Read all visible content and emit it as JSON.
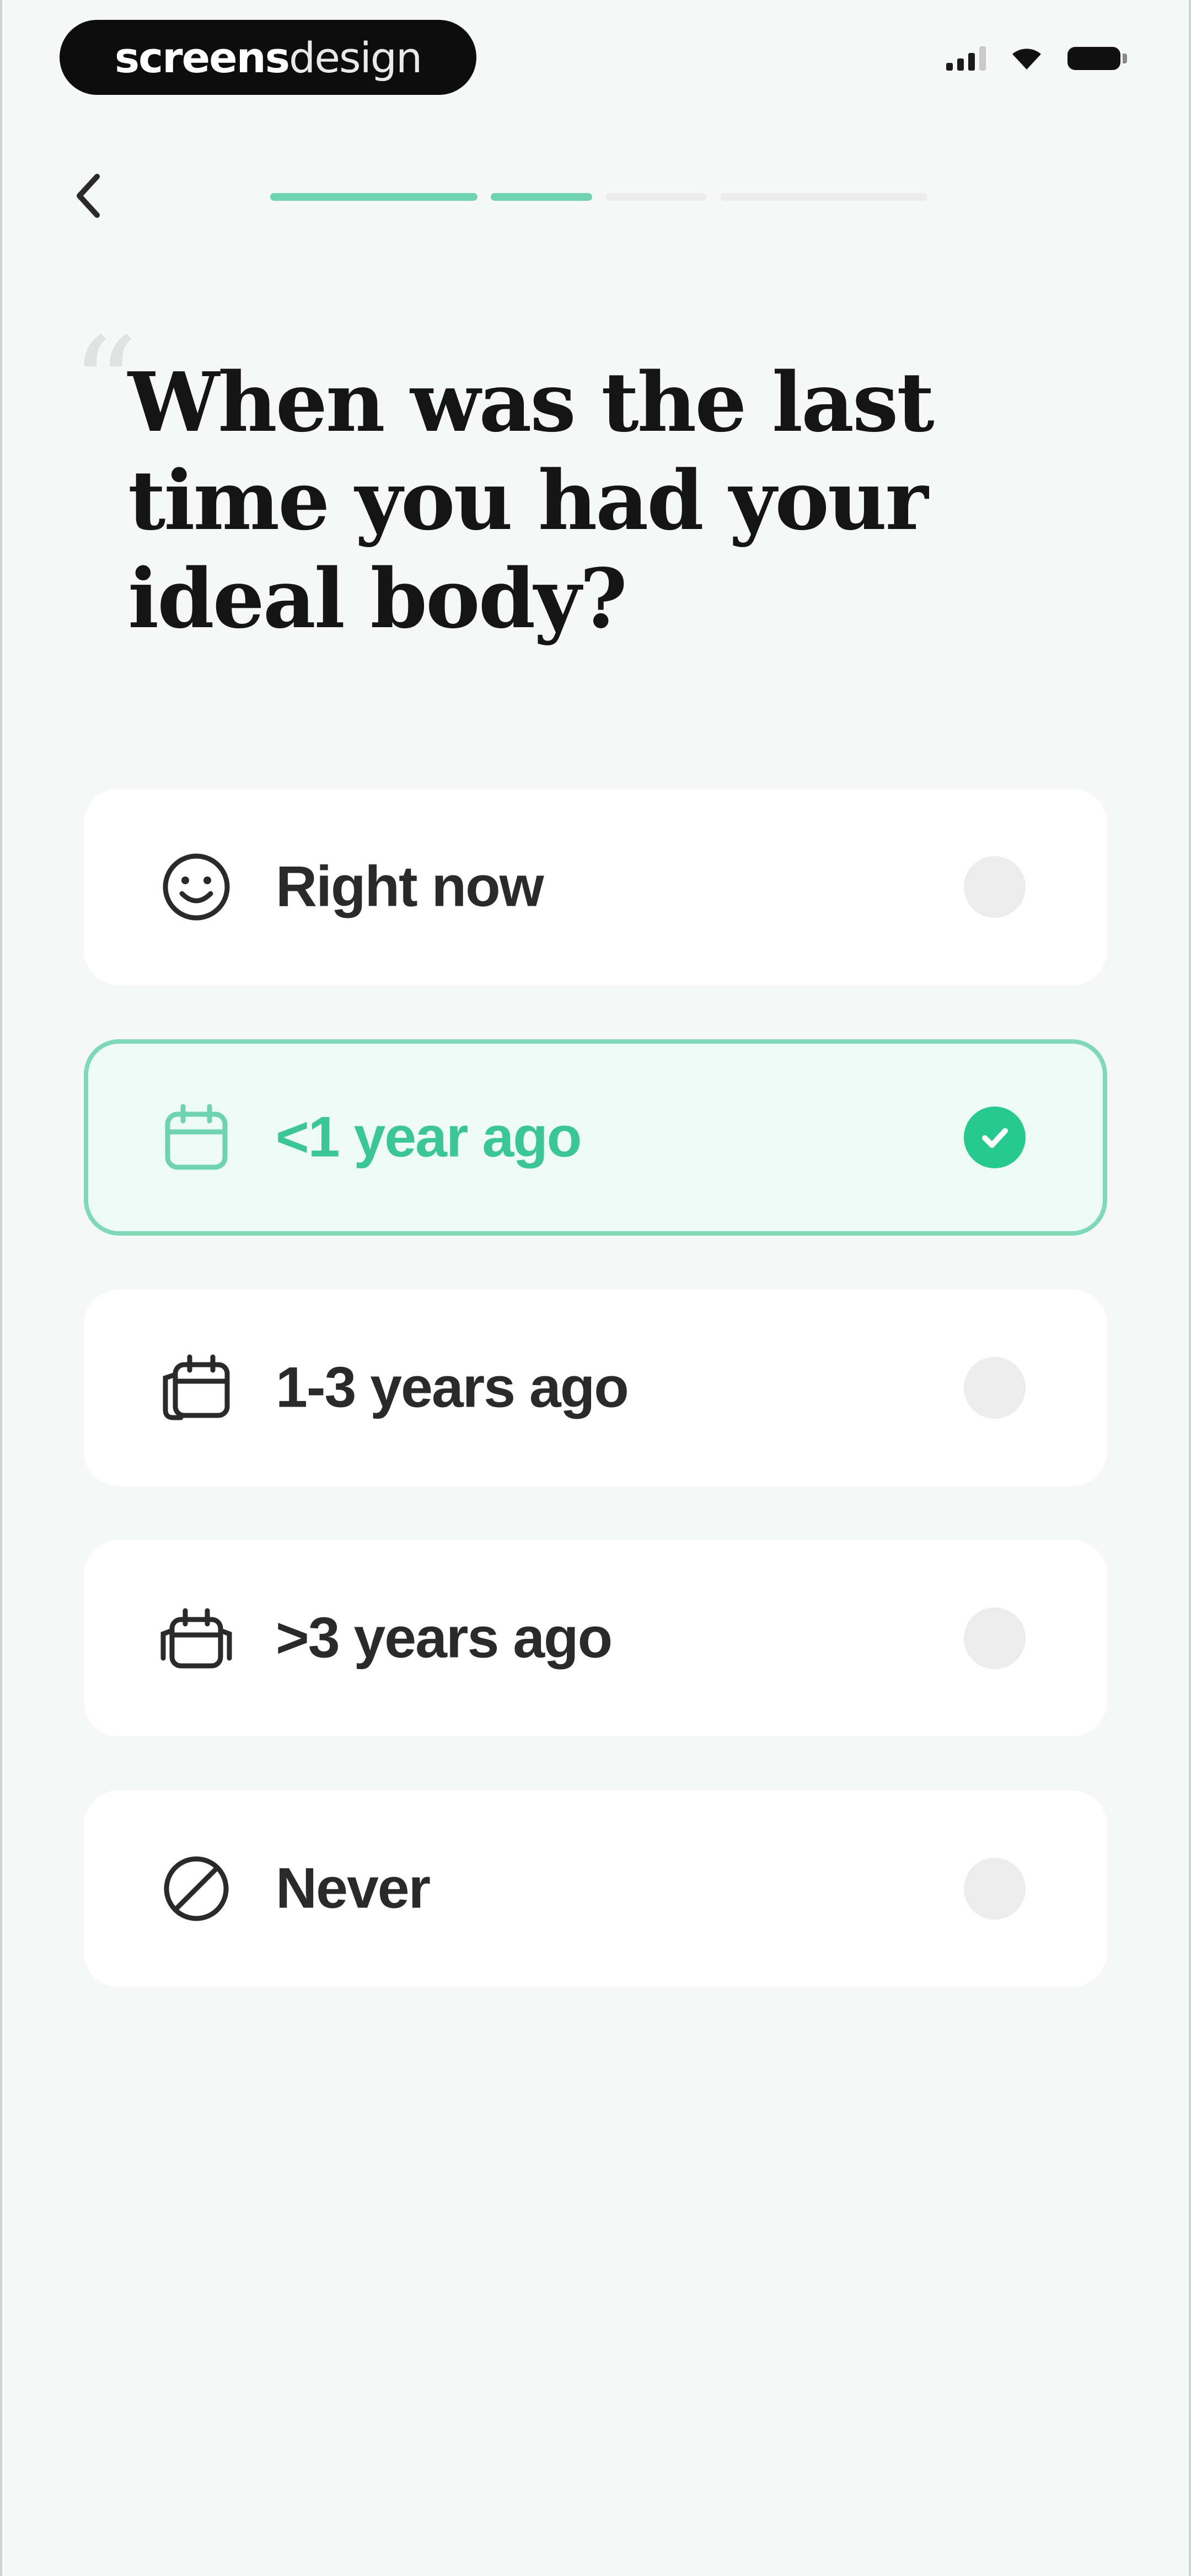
{
  "status_bar": {
    "brand_bold": "screens",
    "brand_light": "design"
  },
  "nav": {
    "back_icon": "chevron-left-icon",
    "progress_steps": [
      {
        "state": "done"
      },
      {
        "state": "done"
      },
      {
        "state": "pending"
      },
      {
        "state": "pending"
      }
    ]
  },
  "question": {
    "title": "When was the last time you had your ideal body?"
  },
  "options": [
    {
      "label": "Right now",
      "icon": "smiley-face-icon",
      "selected": false
    },
    {
      "label": "<1 year ago",
      "icon": "calendar-icon",
      "selected": true
    },
    {
      "label": "1-3 years ago",
      "icon": "calendar-stack-icon",
      "selected": false
    },
    {
      "label": ">3 years ago",
      "icon": "calendar-multi-icon",
      "selected": false
    },
    {
      "label": "Never",
      "icon": "prohibited-icon",
      "selected": false
    }
  ],
  "colors": {
    "accent": "#27c98f",
    "accent_light": "#6fd3b1",
    "selected_bg": "#eefaf5",
    "selected_border": "#7fd9b8",
    "text_dark": "#151515",
    "background": "#f6f8f7"
  }
}
